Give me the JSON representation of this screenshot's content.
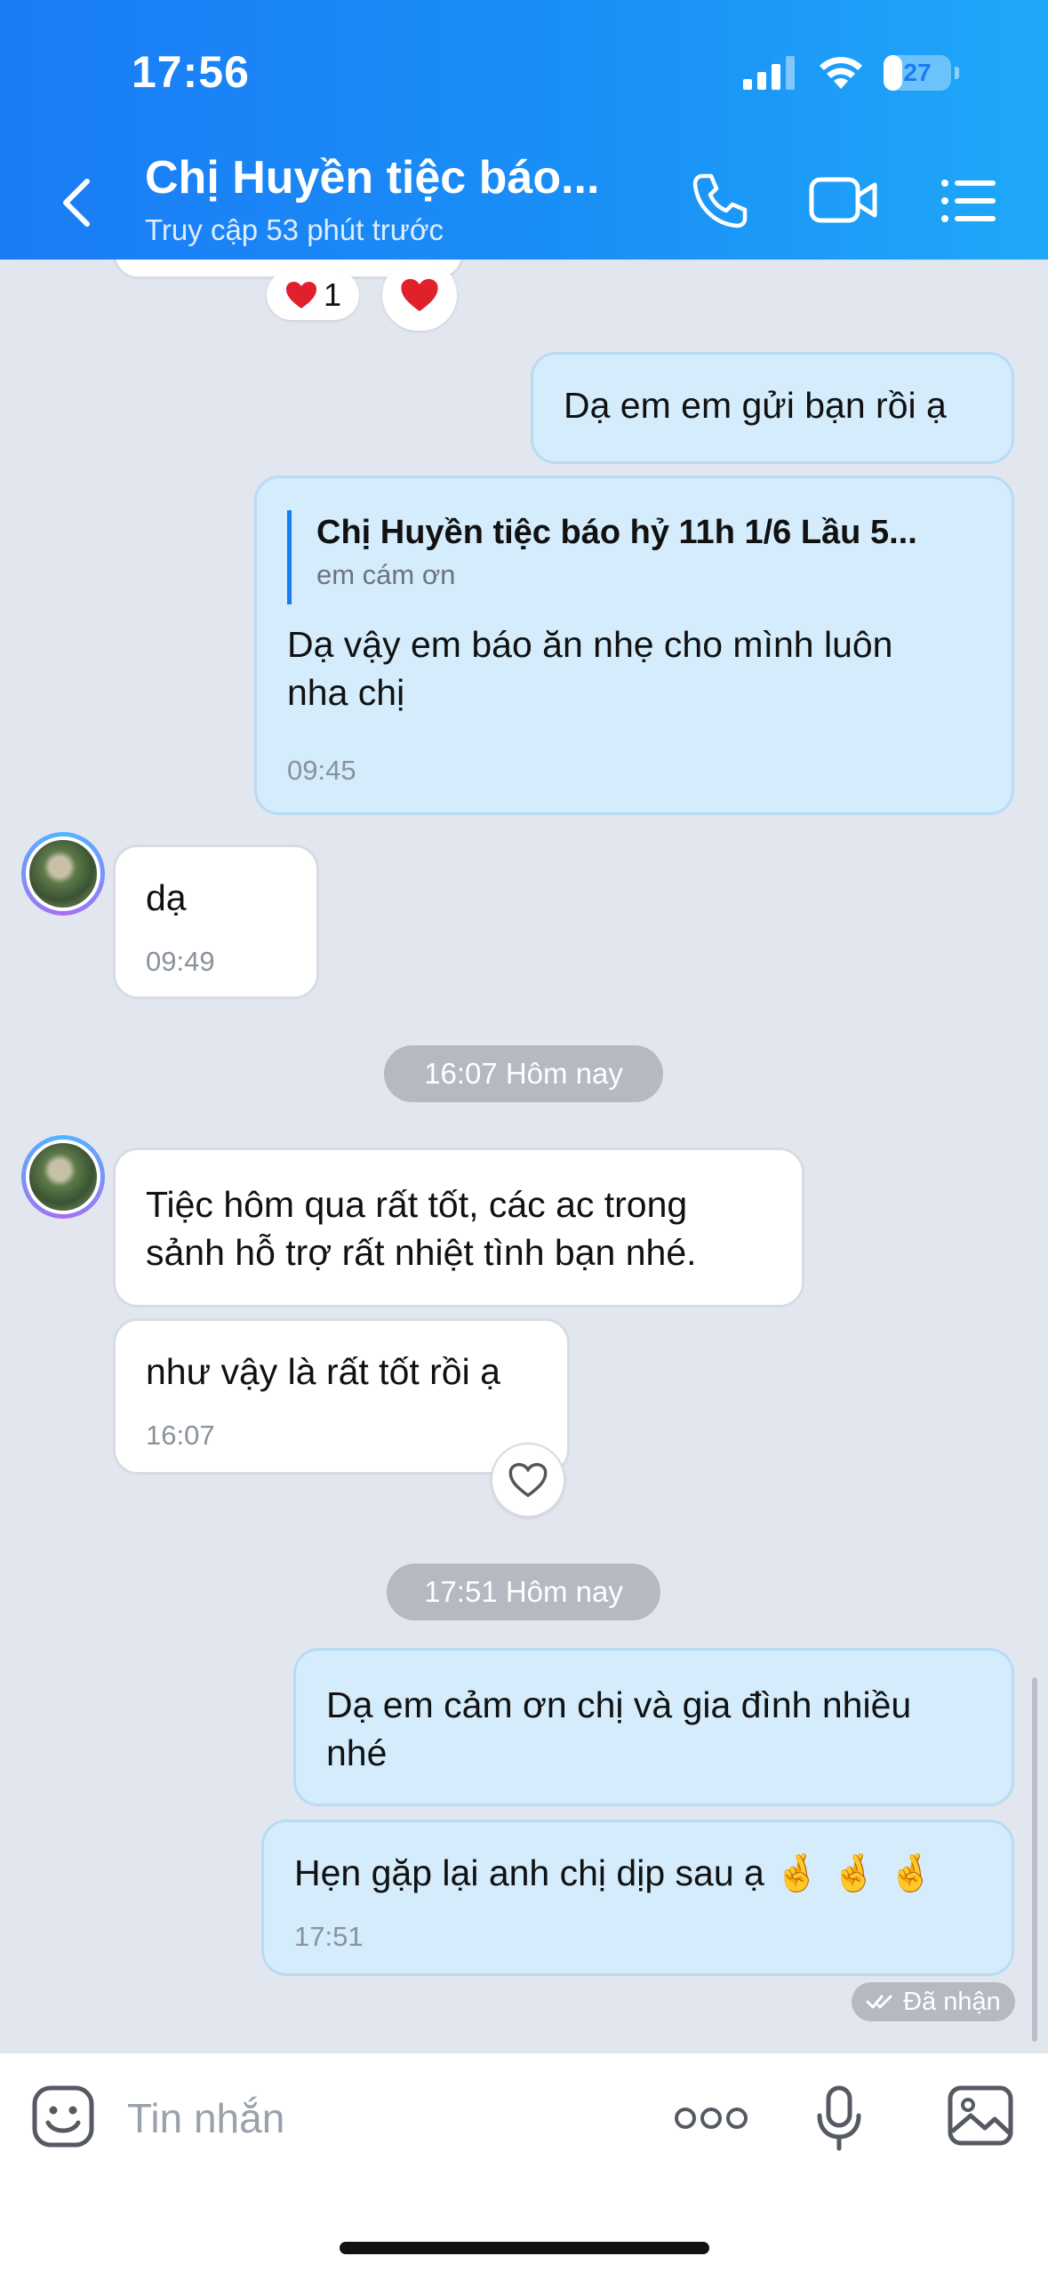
{
  "status_bar": {
    "time": "17:56",
    "battery": "27",
    "battery_level": 0.27
  },
  "header": {
    "title": "Chị Huyền tiệc báo...",
    "subtitle": "Truy cập 53 phút trước",
    "accent": "#1a8ff7"
  },
  "messages": {
    "top_reaction_count": "1",
    "m1": {
      "text": "Dạ em em gửi bạn rồi ạ"
    },
    "m2": {
      "quote_title": "Chị Huyền tiệc báo hỷ 11h 1/6 Lầu 5...",
      "quote_text": "em cám ơn",
      "text_line1": "Dạ vậy em báo ăn nhẹ cho mình luôn",
      "text_line2": "nha chị",
      "time": "09:45"
    },
    "m3": {
      "text": "dạ",
      "time": "09:49"
    },
    "divider1": "16:07 Hôm nay",
    "m4": {
      "line1": "Tiệc hôm qua rất tốt, các ac trong",
      "line2": "sảnh hỗ trợ rất nhiệt tình bạn nhé."
    },
    "m5": {
      "text": "như vậy là rất tốt rồi ạ",
      "time": "16:07"
    },
    "divider2": "17:51 Hôm nay",
    "m6": {
      "line1": "Dạ em cảm ơn chị và gia đình nhiều",
      "line2": "nhé"
    },
    "m7": {
      "text": "Hẹn gặp lại anh chị dịp sau ạ",
      "emojis": "🤞 🤞 🤞",
      "time": "17:51"
    },
    "status": "Đã nhận"
  },
  "input": {
    "placeholder": "Tin nhắn"
  }
}
